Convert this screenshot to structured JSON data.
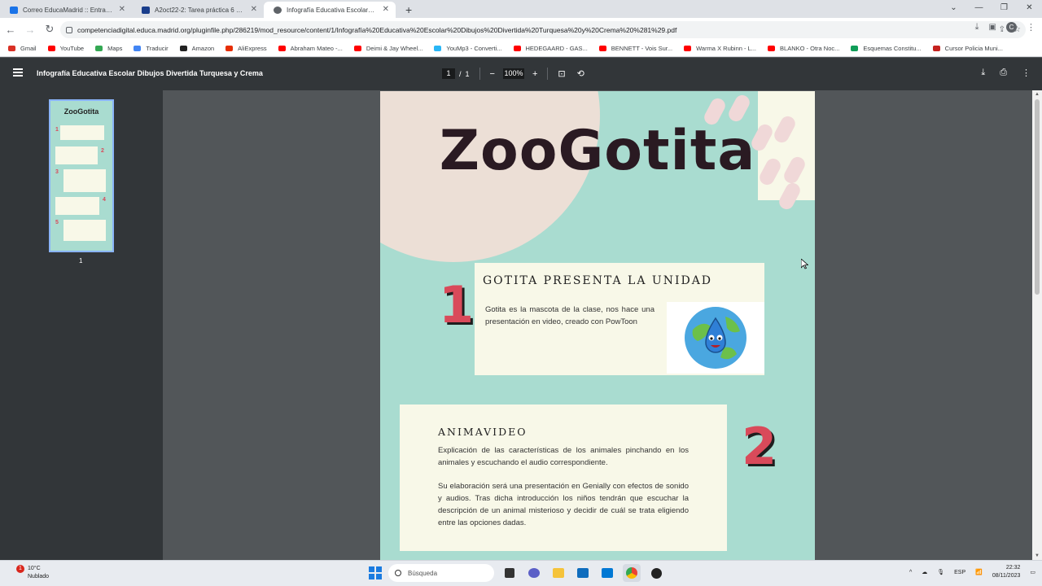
{
  "browser": {
    "tabs": [
      {
        "label": "Correo EducaMadrid :: Entrada",
        "color": "#1a73e8",
        "active": false
      },
      {
        "label": "A2oct22-2: Tarea práctica 6 - Ni",
        "color": "#1a3e8c",
        "active": false
      },
      {
        "label": "Infografía Educativa Escolar Dib",
        "color": "#5f6368",
        "active": true
      }
    ],
    "url": "competenciadigital.educa.madrid.org/pluginfile.php/286219/mod_resource/content/1/Infografía%20Educativa%20Escolar%20Dibujos%20Divertida%20Turquesa%20y%20Crema%20%281%29.pdf",
    "bookmarks": [
      {
        "label": "Gmail",
        "color": "#d93025"
      },
      {
        "label": "YouTube",
        "color": "#ff0000"
      },
      {
        "label": "Maps",
        "color": "#34a853"
      },
      {
        "label": "Traducir",
        "color": "#4285f4"
      },
      {
        "label": "Amazon",
        "color": "#222222"
      },
      {
        "label": "AliExpress",
        "color": "#e62e04"
      },
      {
        "label": "Abraham Mateo -...",
        "color": "#ff0000"
      },
      {
        "label": "Deimi & Jay Wheel...",
        "color": "#ff0000"
      },
      {
        "label": "YouMp3 - Converti...",
        "color": "#29b6f6"
      },
      {
        "label": "HEDEGAARD - GAS...",
        "color": "#ff0000"
      },
      {
        "label": "BENNETT - Vois Sur...",
        "color": "#ff0000"
      },
      {
        "label": "Warma X Rubinn - L...",
        "color": "#ff0000"
      },
      {
        "label": "BLANKO - Otra Noc...",
        "color": "#ff0000"
      },
      {
        "label": "Esquemas Constitu...",
        "color": "#0f9d58"
      },
      {
        "label": "Cursor Policia Muni...",
        "color": "#c5221f"
      }
    ]
  },
  "pdf": {
    "title": "Infografía Educativa Escolar Dibujos Divertida Turquesa y Crema",
    "page_current": "1",
    "page_separator": "/",
    "page_total": "1",
    "zoom": "100%",
    "thumb_label": "1",
    "thumb_title": "ZooGotita"
  },
  "document": {
    "title": "ZooGotita",
    "section1": {
      "number": "1",
      "heading": "GOTITA PRESENTA LA UNIDAD",
      "body": "Gotita es la mascota de la clase, nos hace una presentación en video, creado con PowToon"
    },
    "section2": {
      "number": "2",
      "heading": "ANIMAVIDEO",
      "body1": "Explicación de las características de los animales pinchando en los animales y escuchando el audio correspondiente.",
      "body2": "Su elaboración será una presentación en Genially con efectos de sonido y audios. Tras dicha introducción los niños tendrán que escuchar la descripción de un animal misterioso y decidir de cuál se trata eligiendo entre las opciones dadas."
    }
  },
  "taskbar": {
    "weather_badge": "1",
    "temperature": "10°C",
    "condition": "Nublado",
    "search_placeholder": "Búsqueda",
    "language": "ESP",
    "time": "22:32",
    "date": "08/11/2023"
  }
}
